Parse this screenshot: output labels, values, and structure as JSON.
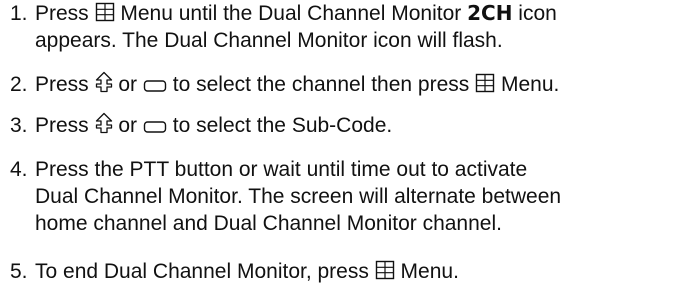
{
  "steps": [
    {
      "number": "1.",
      "l1_a": "Press",
      "l1_icon": "menu-key-icon",
      "l1_b": "Menu until the Dual Channel Monitor",
      "l1_code": "2CH",
      "l1_c": "icon",
      "l2": "appears. The Dual Channel Monitor icon will flash."
    },
    {
      "number": "2.",
      "a": "Press",
      "icon_up": "up-key-icon",
      "or": "or",
      "icon_down": "down-key-icon",
      "b": "to select the channel then press",
      "icon_menu": "menu-key-icon",
      "c": "Menu."
    },
    {
      "number": "3.",
      "a": "Press",
      "icon_up": "up-key-icon",
      "or": "or",
      "icon_down": "down-key-icon",
      "b": "to select the Sub-Code."
    },
    {
      "number": "4.",
      "l1": "Press the PTT button or wait until time out to activate",
      "l2": "Dual Channel Monitor. The screen will alternate between",
      "l3": "home channel and Dual Channel Monitor channel."
    },
    {
      "number": "5.",
      "a": "To end Dual Channel Monitor, press",
      "icon_menu": "menu-key-icon",
      "b": "Menu."
    }
  ]
}
